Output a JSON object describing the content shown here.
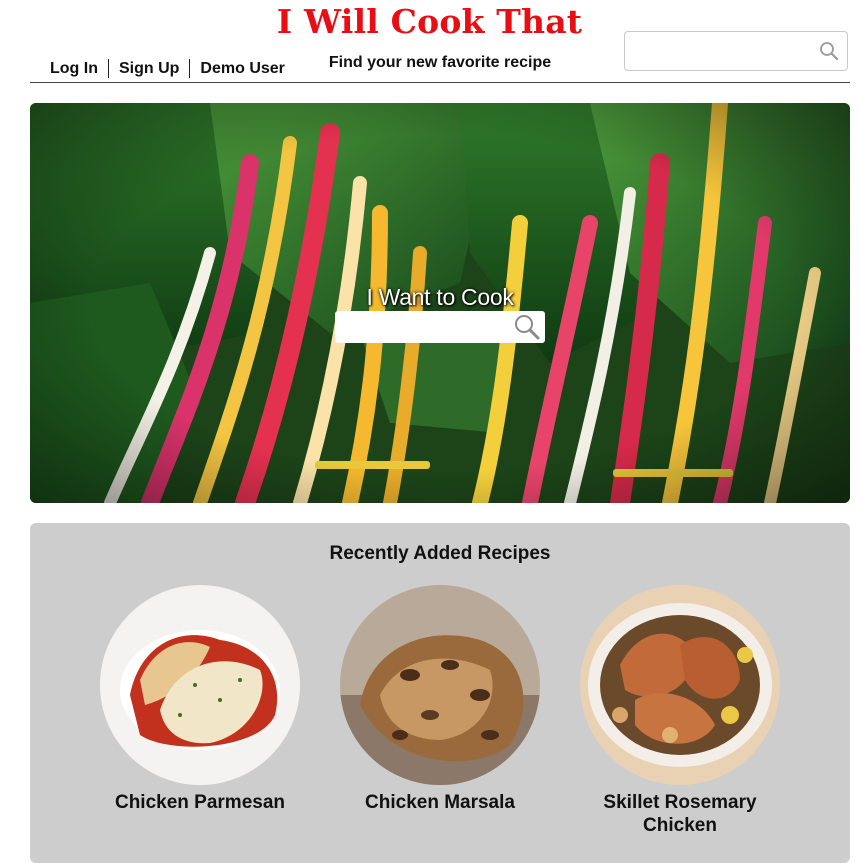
{
  "header": {
    "title": "I Will Cook That",
    "tagline": "Find your new favorite recipe",
    "auth_links": [
      "Log In",
      "Sign Up",
      "Demo User"
    ],
    "search": {
      "value": "",
      "icon": "search-icon"
    }
  },
  "hero": {
    "heading": "I Want to Cook",
    "search": {
      "value": "",
      "icon": "search-icon"
    }
  },
  "recent": {
    "heading": "Recently Added Recipes",
    "recipes": [
      {
        "name": "Chicken Parmesan"
      },
      {
        "name": "Chicken Marsala"
      },
      {
        "name": "Skillet Rosemary Chicken"
      }
    ]
  },
  "colors": {
    "brand": "#e80e14",
    "panel": "#cdcdcd"
  }
}
